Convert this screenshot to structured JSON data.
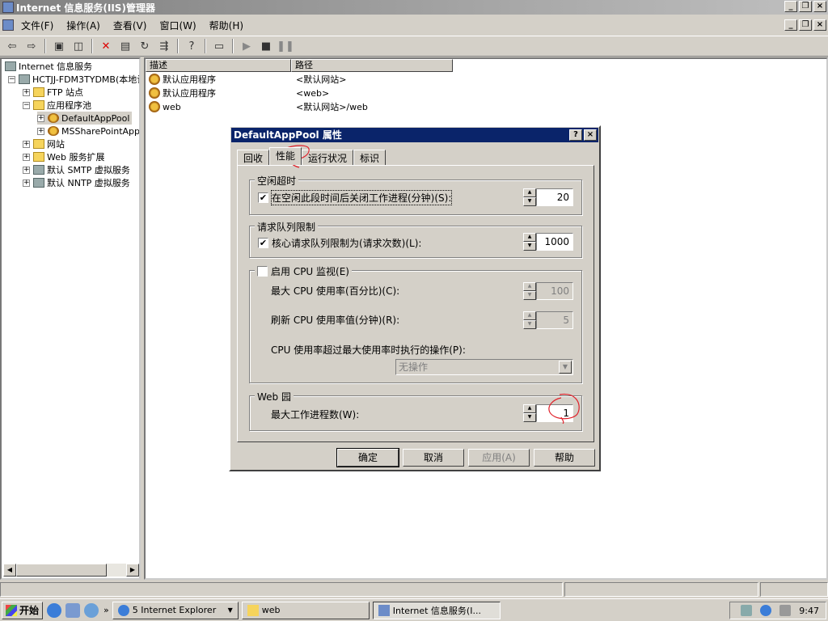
{
  "app": {
    "title": "Internet 信息服务(IIS)管理器"
  },
  "menu": [
    "文件(F)",
    "操作(A)",
    "查看(V)",
    "窗口(W)",
    "帮助(H)"
  ],
  "tree": {
    "root": "Internet 信息服务",
    "server": "HCTJJ-FDM3TYDMB(本地计",
    "items": [
      "FTP 站点",
      "应用程序池",
      "DefaultAppPool",
      "MSSharePointApp",
      "网站",
      "Web 服务扩展",
      "默认 SMTP 虚拟服务",
      "默认 NNTP 虚拟服务"
    ]
  },
  "list": {
    "headers": [
      "描述",
      "路径"
    ],
    "rows": [
      {
        "name": "默认应用程序",
        "path": "<默认网站>"
      },
      {
        "name": "默认应用程序",
        "path": "<web>"
      },
      {
        "name": "web",
        "path": "<默认网站>/web"
      }
    ]
  },
  "dialog": {
    "title": "DefaultAppPool 属性",
    "tabs": [
      "回收",
      "性能",
      "运行状况",
      "标识"
    ],
    "active_tab": "性能",
    "idle": {
      "legend": "空闲超时",
      "label": "在空闲此段时间后关闭工作进程(分钟)(S):",
      "checked": true,
      "value": "20"
    },
    "queue": {
      "legend": "请求队列限制",
      "label": "核心请求队列限制为(请求次数)(L):",
      "checked": true,
      "value": "1000"
    },
    "cpu": {
      "legend": "启用 CPU 监视(E)",
      "checked": false,
      "max_label": "最大 CPU 使用率(百分比)(C):",
      "max_value": "100",
      "refresh_label": "刷新 CPU 使用率值(分钟)(R):",
      "refresh_value": "5",
      "action_label": "CPU 使用率超过最大使用率时执行的操作(P):",
      "action_value": "无操作"
    },
    "webgarden": {
      "legend": "Web 园",
      "label": "最大工作进程数(W):",
      "value": "1"
    },
    "buttons": {
      "ok": "确定",
      "cancel": "取消",
      "apply": "应用(A)",
      "help": "帮助"
    }
  },
  "taskbar": {
    "start": "开始",
    "tasks": [
      "5 Internet Explorer",
      "web",
      "Internet 信息服务(I..."
    ],
    "time": "9:47"
  },
  "colors": {
    "dialog_titlebar": "#0a246a",
    "annotation": "#e0202a"
  }
}
